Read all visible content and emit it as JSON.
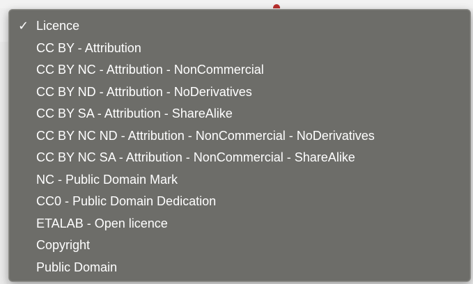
{
  "menu": {
    "selected_index": 0,
    "check_glyph": "✓",
    "items": [
      {
        "label": "Licence"
      },
      {
        "label": "CC BY - Attribution"
      },
      {
        "label": "CC BY NC - Attribution - NonCommercial"
      },
      {
        "label": "CC BY ND - Attribution - NoDerivatives"
      },
      {
        "label": "CC BY SA - Attribution - ShareAlike"
      },
      {
        "label": "CC BY NC ND - Attribution - NonCommercial - NoDerivatives"
      },
      {
        "label": "CC BY NC SA - Attribution - NonCommercial - ShareAlike"
      },
      {
        "label": "NC - Public Domain Mark"
      },
      {
        "label": "CC0 - Public Domain Dedication"
      },
      {
        "label": "ETALAB - Open licence"
      },
      {
        "label": "Copyright"
      },
      {
        "label": "Public Domain"
      }
    ]
  },
  "colors": {
    "menu_background": "#686864",
    "menu_text": "#ffffff"
  }
}
